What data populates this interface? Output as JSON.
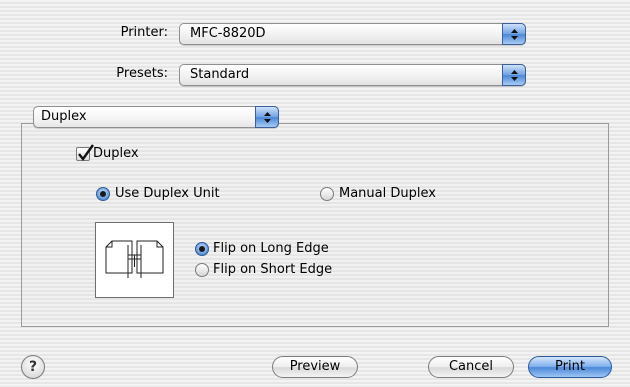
{
  "printer": {
    "label": "Printer:",
    "value": "MFC-8820D"
  },
  "presets": {
    "label": "Presets:",
    "value": "Standard"
  },
  "panel_menu": {
    "value": "Duplex"
  },
  "duplex": {
    "checkbox_label": "Duplex",
    "checked": true,
    "mode": {
      "use_unit_label": "Use Duplex Unit",
      "manual_label": "Manual Duplex",
      "selected": "use_unit"
    },
    "binding": {
      "long_edge_label": "Flip on Long Edge",
      "short_edge_label": "Flip on Short Edge",
      "selected": "long_edge"
    }
  },
  "buttons": {
    "help": "?",
    "preview": "Preview",
    "cancel": "Cancel",
    "print": "Print"
  },
  "colors": {
    "accent": "#4b88d8"
  }
}
